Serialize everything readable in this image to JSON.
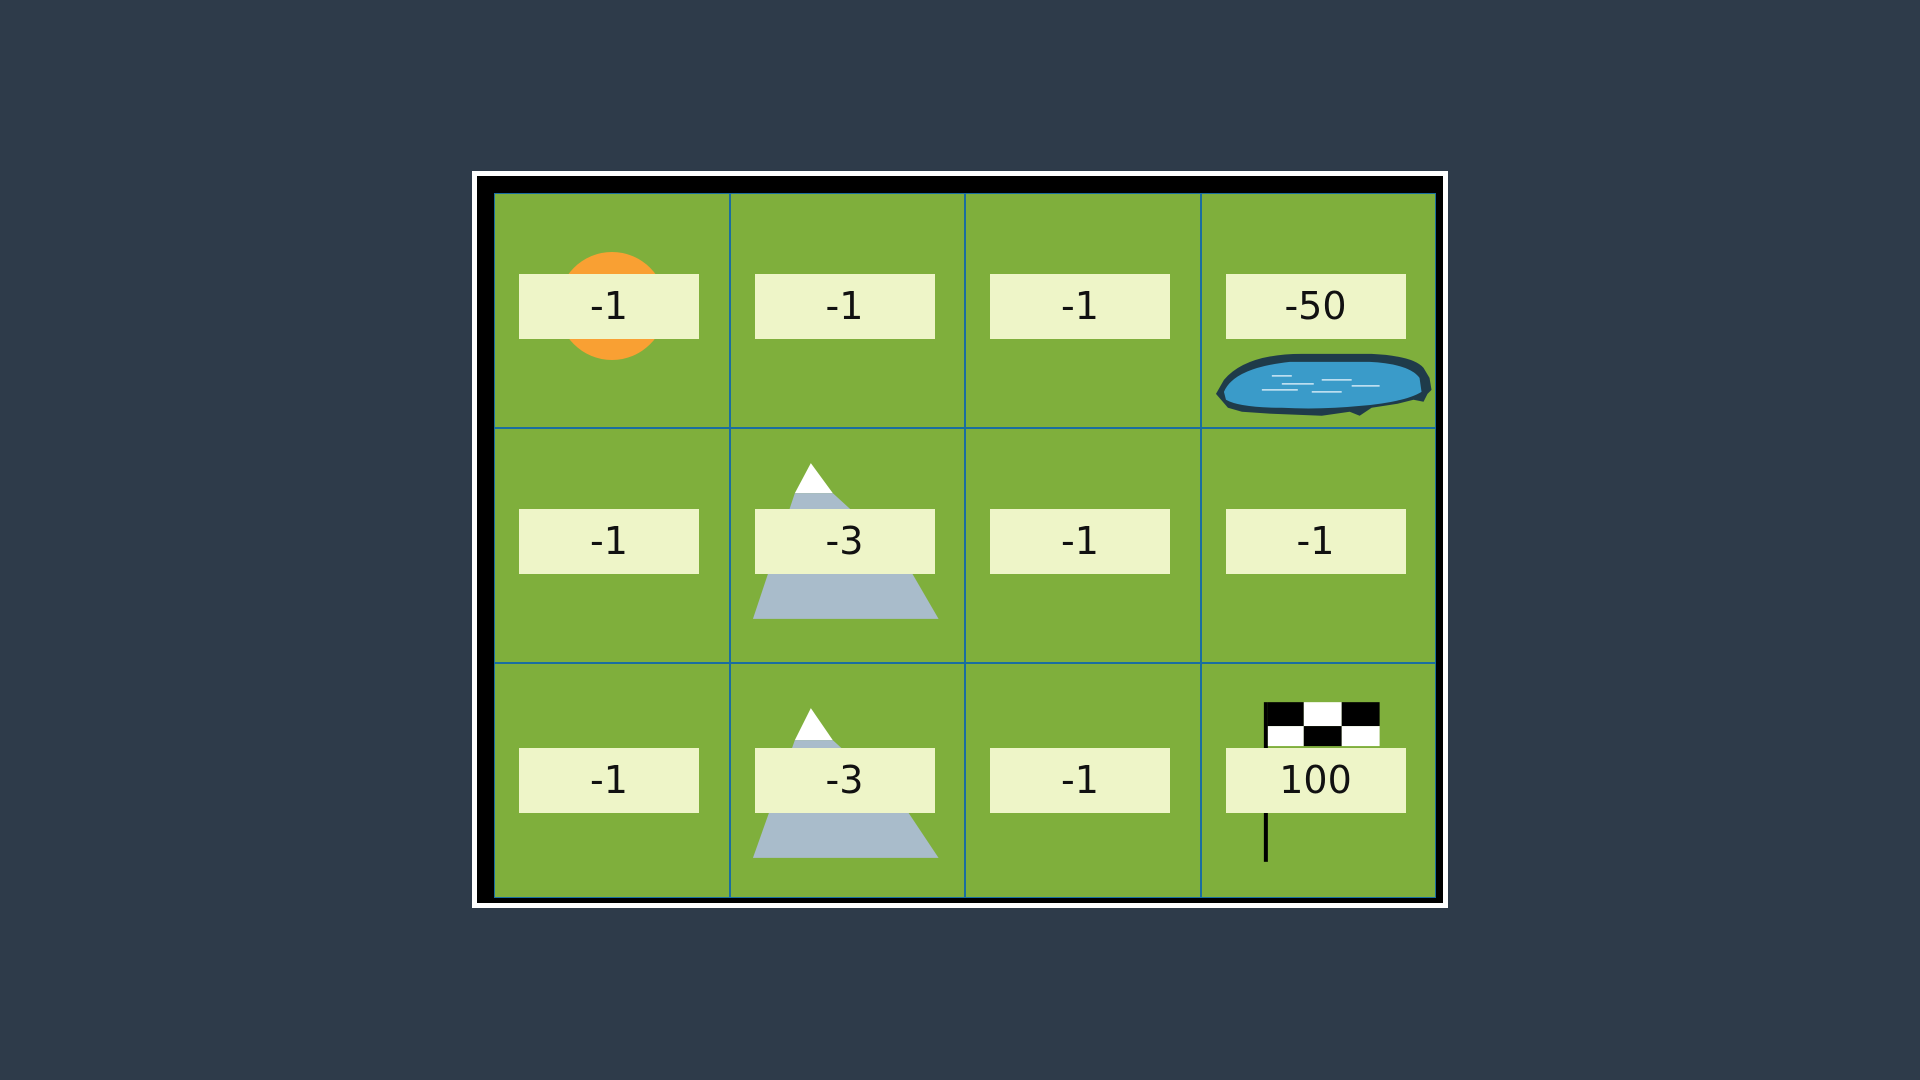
{
  "grid": {
    "rows": 3,
    "cols": 4,
    "cells": [
      [
        {
          "reward": "-1",
          "object": "sun-icon"
        },
        {
          "reward": "-1",
          "object": null
        },
        {
          "reward": "-1",
          "object": null
        },
        {
          "reward": "-50",
          "object": "pond-icon"
        }
      ],
      [
        {
          "reward": "-1",
          "object": null
        },
        {
          "reward": "-3",
          "object": "mountain-icon"
        },
        {
          "reward": "-1",
          "object": null
        },
        {
          "reward": "-1",
          "object": null
        }
      ],
      [
        {
          "reward": "-1",
          "object": null
        },
        {
          "reward": "-3",
          "object": "mountain-icon"
        },
        {
          "reward": "-1",
          "object": null
        },
        {
          "reward": "100",
          "object": "finish-flag-icon"
        }
      ]
    ]
  },
  "colors": {
    "background": "#2e3b4a",
    "grass": "#7faf3c",
    "grid_line": "#1a6ea0",
    "label_bg": "#eef5c8",
    "sun": "#f9a033",
    "water": "#3a9bc9",
    "mountain": "#a9bccb"
  }
}
